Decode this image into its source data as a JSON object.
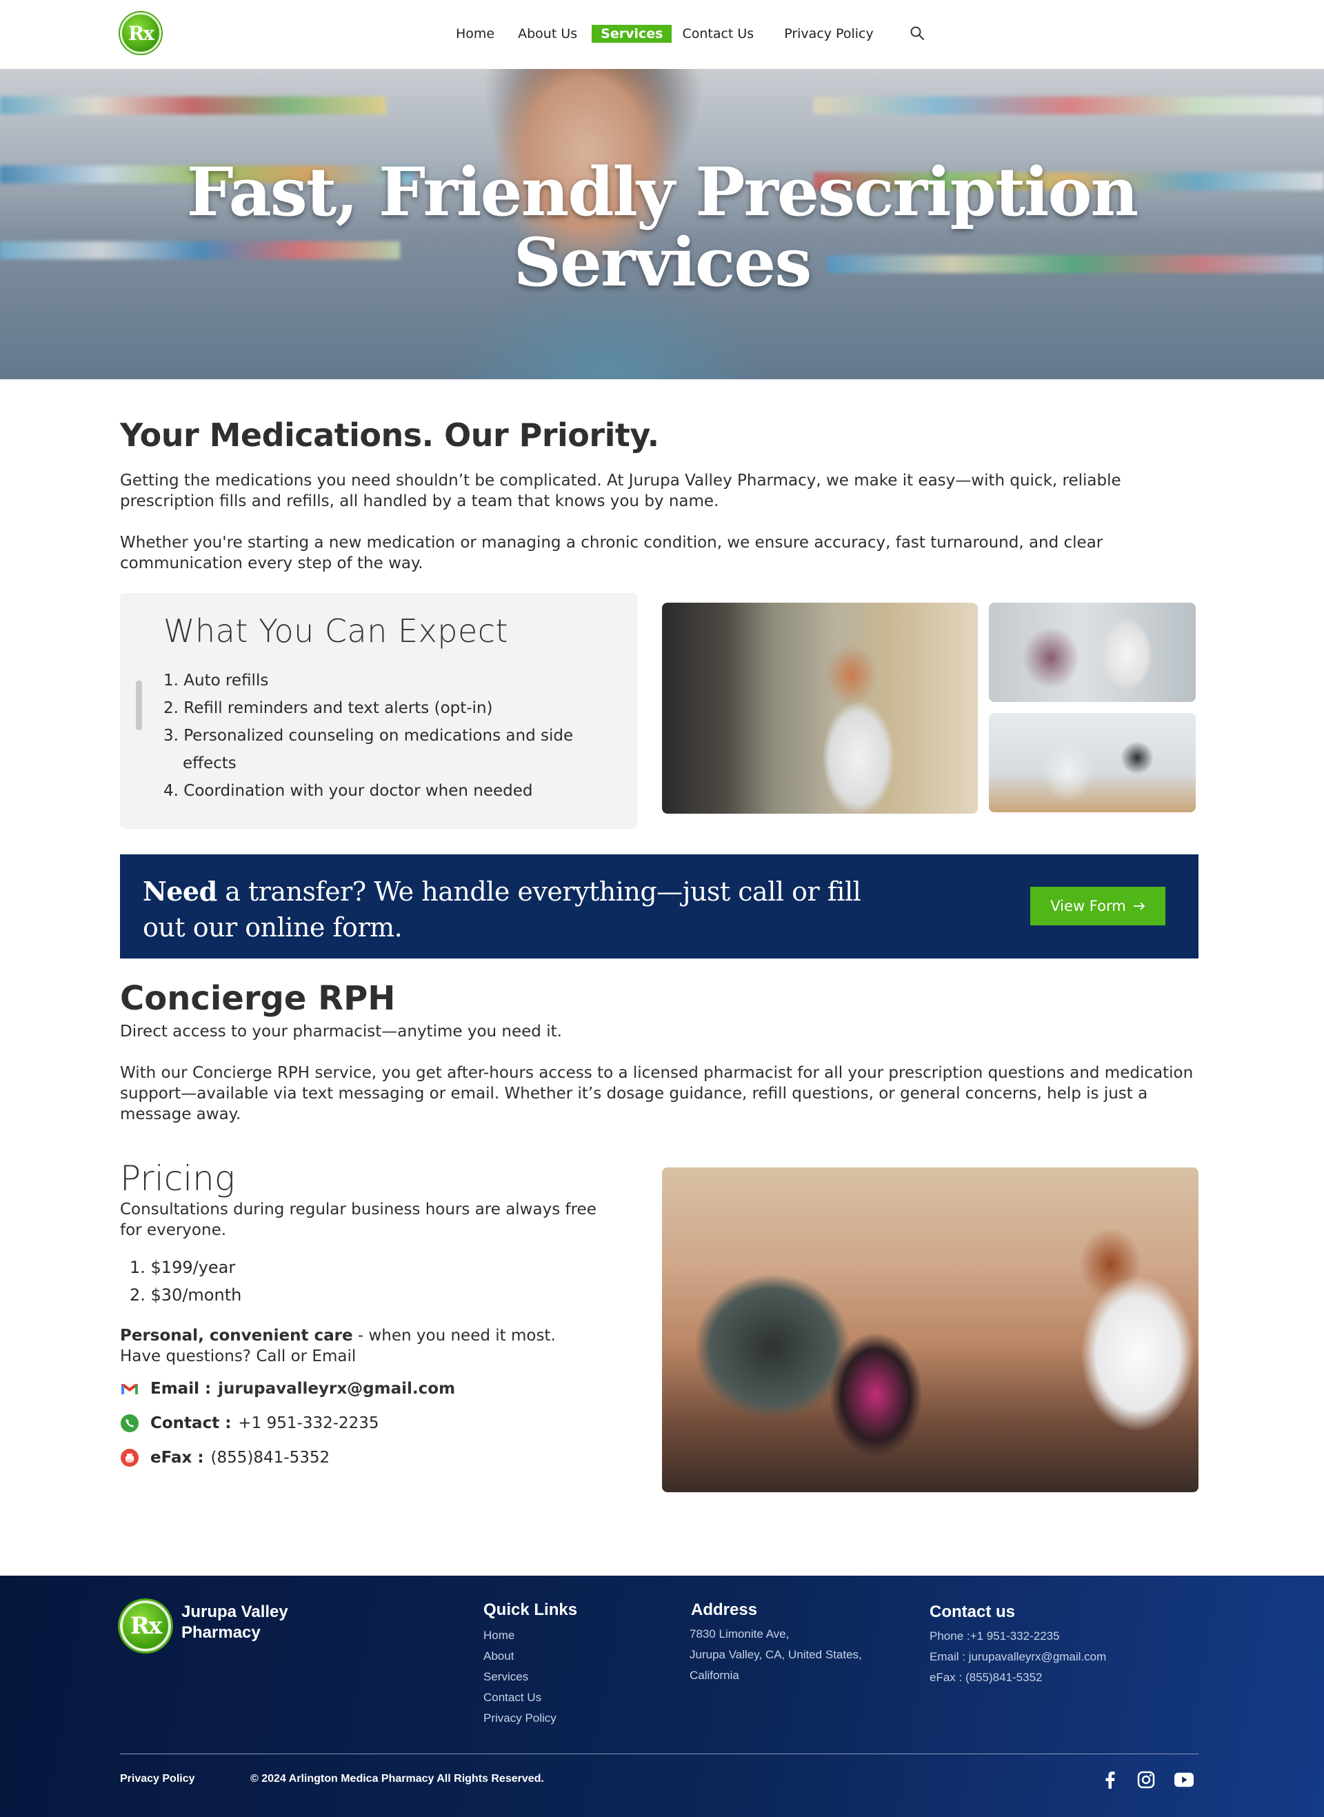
{
  "brand": {
    "logo_text": "Rx",
    "name": "Jurupa Valley Pharmacy",
    "accent": "#51b618",
    "navy": "#0c2a5e"
  },
  "nav": {
    "items": [
      "Home",
      "About Us",
      "Services",
      "Contact Us",
      "Privacy Policy"
    ],
    "active": "Services",
    "search_icon": "search-icon"
  },
  "hero": {
    "title_line1": "Fast, Friendly Prescription",
    "title_line2": "Services"
  },
  "intro": {
    "heading": "Your Medications. Our Priority.",
    "para1": "Getting the medications you need shouldn’t be complicated. At Jurupa Valley Pharmacy, we make it easy—with quick, reliable prescription fills and refills, all handled by a team that knows you by name.",
    "para2": "Whether you're starting a new medication or managing a chronic condition, we ensure accuracy, fast turnaround, and clear communication every step of the way."
  },
  "expect": {
    "title": "What You Can Expect",
    "items": [
      "1. Auto refills",
      "2. Refill reminders and text alerts (opt-in)",
      "3. Personalized counseling on medications and side effects",
      "4. Coordination with your doctor when needed"
    ]
  },
  "banner": {
    "bold": "Need",
    "text": " a transfer? We handle everything—just call or fill out our online form.",
    "button_label": "View Form",
    "button_icon": "arrow-right-icon"
  },
  "concierge": {
    "heading": "Concierge RPH",
    "subtitle": "Direct access to your pharmacist—anytime you need it.",
    "body": "With our Concierge RPH service, you get after-hours access to a licensed pharmacist for all your prescription questions and medication support—available via text messaging or email. Whether it’s dosage guidance, refill questions, or general concerns, help is just a message away."
  },
  "pricing": {
    "heading": "Pricing",
    "note": "Consultations during regular business hours are always free for everyone.",
    "plans": [
      "1. $199/year",
      "2. $30/month"
    ],
    "tagline_bold": "Personal, convenient care",
    "tagline_rest": " - when you need it most.",
    "tagline_line2": "Have questions? Call or Email",
    "contacts": [
      {
        "label": "Email :",
        "value": "jurupavalleyrx@gmail.com",
        "icon": "gmail-icon"
      },
      {
        "label": "Contact :",
        "value": "+1 951-332-2235",
        "icon": "phone-icon"
      },
      {
        "label": "eFax :",
        "value": "(855)841-5352",
        "icon": "fax-icon"
      }
    ]
  },
  "footer": {
    "brand": "Jurupa Valley Pharmacy",
    "quick_links_title": "Quick Links",
    "quick_links": [
      "Home",
      "About",
      "Services",
      "Contact Us",
      "Privacy Policy"
    ],
    "address_title": "Address",
    "address_lines": [
      "7830 Limonite Ave,",
      "Jurupa Valley, CA, United States,",
      "California"
    ],
    "contact_title": "Contact us",
    "contact_lines": [
      "Phone :+1 951-332-2235",
      "Email : jurupavalleyrx@gmail.com",
      "eFax : (855)841-5352"
    ],
    "privacy": "Privacy Policy",
    "copyright": "© 2024 Arlington Medica Pharmacy All Rights Reserved.",
    "social": [
      "facebook-icon",
      "instagram-icon",
      "youtube-icon"
    ]
  }
}
